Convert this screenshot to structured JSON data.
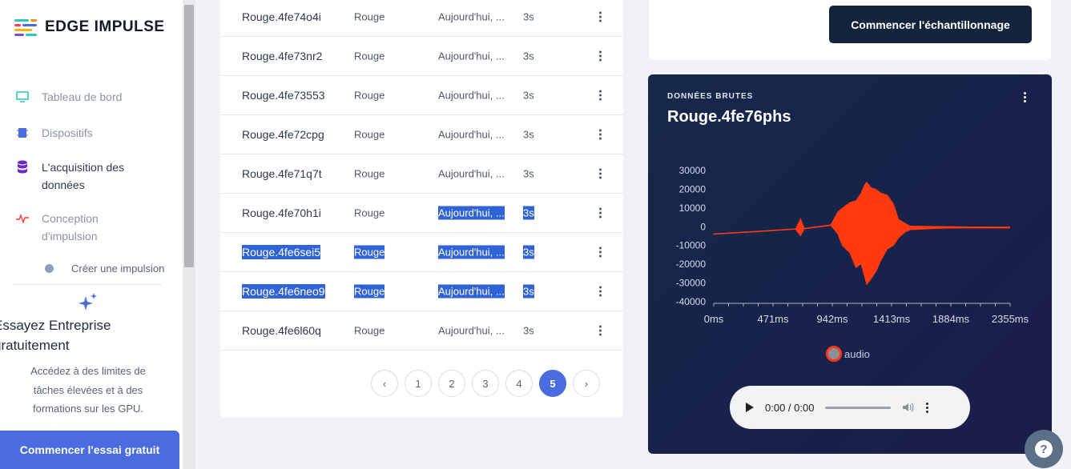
{
  "brand": {
    "name": "EDGE IMPULSE"
  },
  "sidebar": {
    "items": [
      {
        "label": "Tableau de bord",
        "icon": "monitor-icon"
      },
      {
        "label": "Dispositifs",
        "icon": "chip-icon"
      },
      {
        "label": "L'acquisition des données",
        "icon": "database-icon",
        "active": true
      },
      {
        "label": "Conception d'impulsion",
        "icon": "pulse-icon"
      }
    ],
    "sub_item": "Créer une impulsion",
    "promo": {
      "title": "Essayez Entreprise gratuitement",
      "description": "Accédez à des limites de tâches élevées et à des formations sur les GPU.",
      "cta": "Commencer l'essai gratuit"
    }
  },
  "samples": {
    "rows": [
      {
        "name": "Rouge.4fe74o4i",
        "label": "Rouge",
        "added": "Aujourd'hui, ...",
        "length": "3s",
        "selected": false,
        "partial": false
      },
      {
        "name": "Rouge.4fe73nr2",
        "label": "Rouge",
        "added": "Aujourd'hui, ...",
        "length": "3s",
        "selected": false,
        "partial": false
      },
      {
        "name": "Rouge.4fe73553",
        "label": "Rouge",
        "added": "Aujourd'hui, ...",
        "length": "3s",
        "selected": false,
        "partial": false
      },
      {
        "name": "Rouge.4fe72cpg",
        "label": "Rouge",
        "added": "Aujourd'hui, ...",
        "length": "3s",
        "selected": false,
        "partial": false
      },
      {
        "name": "Rouge.4fe71q7t",
        "label": "Rouge",
        "added": "Aujourd'hui, ...",
        "length": "3s",
        "selected": false,
        "partial": false
      },
      {
        "name": "Rouge.4fe70h1i",
        "label": "Rouge",
        "added": "Aujourd'hui, ...",
        "length": "3s",
        "selected": false,
        "partial": true
      },
      {
        "name": "Rouge.4fe6sei5",
        "label": "Rouge",
        "added": "Aujourd'hui, ...",
        "length": "3s",
        "selected": true,
        "partial": false
      },
      {
        "name": "Rouge.4fe6neo9",
        "label": "Rouge",
        "added": "Aujourd'hui, ...",
        "length": "3s",
        "selected": true,
        "partial": false
      },
      {
        "name": "Rouge.4fe6l60q",
        "label": "Rouge",
        "added": "Aujourd'hui, ...",
        "length": "3s",
        "selected": false,
        "partial": false
      }
    ],
    "pagination": {
      "prev": "‹",
      "pages": [
        "1",
        "2",
        "3",
        "4",
        "5"
      ],
      "current": "5",
      "next": "›"
    }
  },
  "actions": {
    "start_sampling": "Commencer l'échantillonnage"
  },
  "raw_data": {
    "kicker": "DONNÉES BRUTES",
    "sample_name": "Rouge.4fe76phs",
    "legend": "audio",
    "player": {
      "time": "0:00 / 0:00"
    }
  },
  "chart_data": {
    "type": "line",
    "series": [
      {
        "name": "audio",
        "color": "#ff3a10"
      }
    ],
    "x_tick_labels": [
      "0ms",
      "471ms",
      "942ms",
      "1413ms",
      "1884ms",
      "2355ms"
    ],
    "y_tick_labels": [
      "30000",
      "20000",
      "10000",
      "0",
      "-10000",
      "-20000",
      "-30000",
      "-40000"
    ],
    "ylim": [
      -40000,
      30000
    ],
    "xlim": [
      0,
      2355
    ],
    "envelope": [
      {
        "x": 0,
        "min": -4200,
        "max": -3600
      },
      {
        "x": 400,
        "min": -2600,
        "max": -2000
      },
      {
        "x": 650,
        "min": -1500,
        "max": -900
      },
      {
        "x": 690,
        "min": -5000,
        "max": 4500
      },
      {
        "x": 720,
        "min": -1300,
        "max": -700
      },
      {
        "x": 930,
        "min": 500,
        "max": 1200
      },
      {
        "x": 985,
        "min": -4000,
        "max": 8000
      },
      {
        "x": 1020,
        "min": -10000,
        "max": 10000
      },
      {
        "x": 1080,
        "min": -14000,
        "max": 13000
      },
      {
        "x": 1130,
        "min": -22000,
        "max": 14000
      },
      {
        "x": 1170,
        "min": -20000,
        "max": 18000
      },
      {
        "x": 1195,
        "min": -26000,
        "max": 22000
      },
      {
        "x": 1215,
        "min": -31000,
        "max": 24000
      },
      {
        "x": 1250,
        "min": -28000,
        "max": 21000
      },
      {
        "x": 1290,
        "min": -24000,
        "max": 20000
      },
      {
        "x": 1330,
        "min": -18000,
        "max": 18000
      },
      {
        "x": 1380,
        "min": -12000,
        "max": 17000
      },
      {
        "x": 1430,
        "min": -10000,
        "max": 12000
      },
      {
        "x": 1470,
        "min": -6000,
        "max": 4000
      },
      {
        "x": 1520,
        "min": -3000,
        "max": 2000
      },
      {
        "x": 1560,
        "min": -1800,
        "max": 500
      },
      {
        "x": 1800,
        "min": -1000,
        "max": 300
      },
      {
        "x": 2000,
        "min": -800,
        "max": 100
      },
      {
        "x": 2355,
        "min": -800,
        "max": 0
      }
    ]
  }
}
